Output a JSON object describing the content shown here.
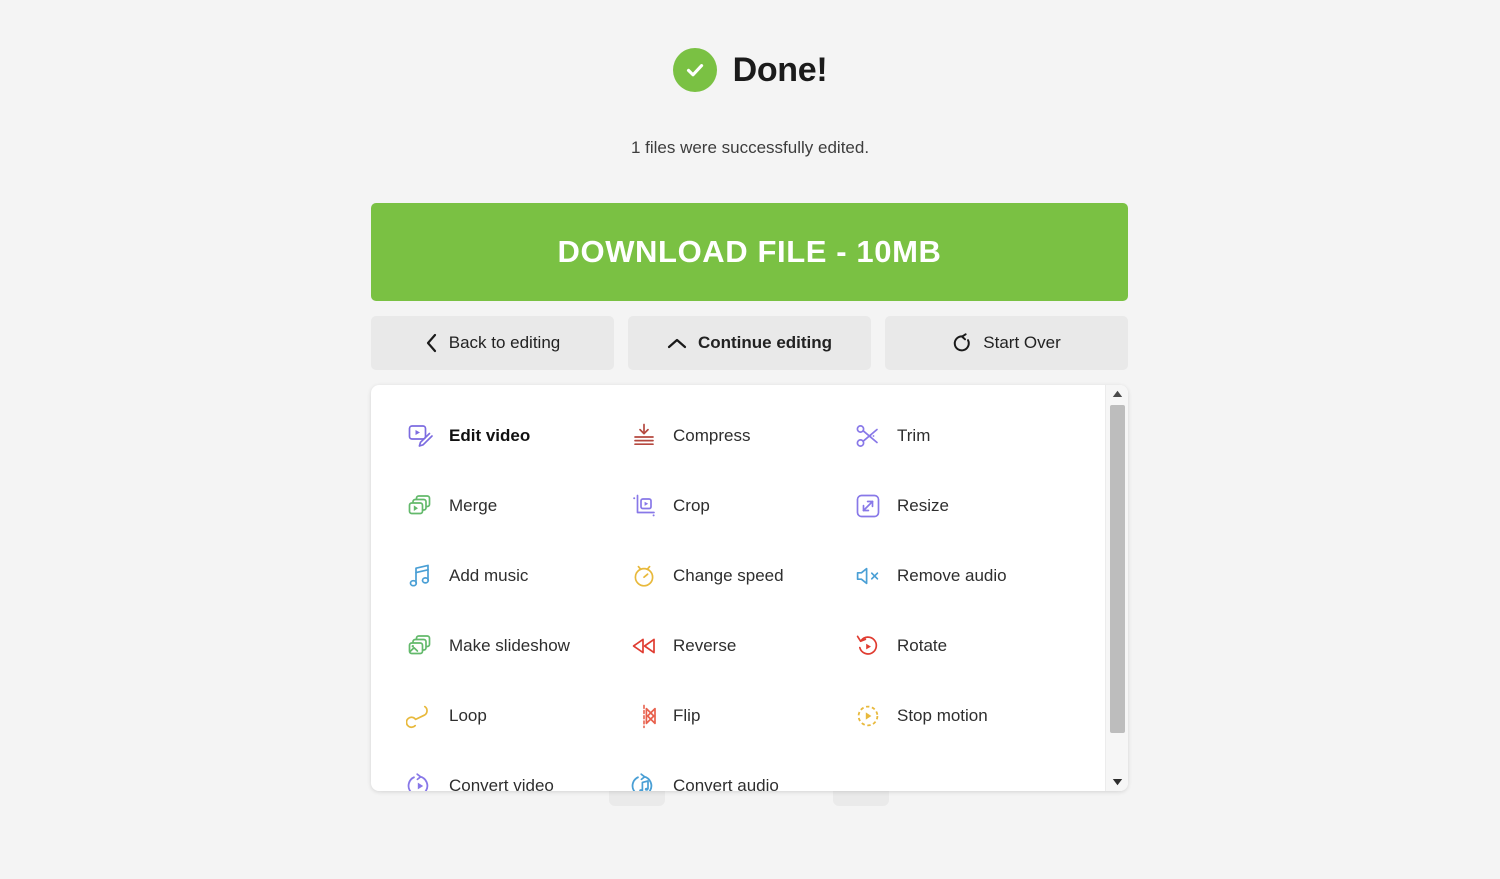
{
  "header": {
    "status_icon": "check-circle-icon",
    "title": "Done!",
    "subtitle": "1 files were successfully edited.",
    "accent_green": "#7ac143"
  },
  "download": {
    "label": "DOWNLOAD FILE - 10MB",
    "color": "#7ac143"
  },
  "actions": [
    {
      "label": "Back to editing",
      "icon": "chevron-left-icon",
      "bold": false
    },
    {
      "label": "Continue editing",
      "icon": "chevron-up-icon",
      "bold": true
    },
    {
      "label": "Start Over",
      "icon": "refresh-icon",
      "bold": false
    }
  ],
  "tools": [
    {
      "label": "Edit video",
      "icon": "video-edit-icon",
      "color": "#7c6ce0",
      "active": true
    },
    {
      "label": "Compress",
      "icon": "compress-icon",
      "color": "#b5483f",
      "active": false
    },
    {
      "label": "Trim",
      "icon": "scissors-icon",
      "color": "#8878e8",
      "active": false
    },
    {
      "label": "Merge",
      "icon": "merge-layers-icon",
      "color": "#63b96b",
      "active": false
    },
    {
      "label": "Crop",
      "icon": "crop-icon",
      "color": "#8878e8",
      "active": false
    },
    {
      "label": "Resize",
      "icon": "resize-arrows-icon",
      "color": "#8878e8",
      "active": false
    },
    {
      "label": "Add music",
      "icon": "music-note-icon",
      "color": "#4a9fd5",
      "active": false
    },
    {
      "label": "Change speed",
      "icon": "stopwatch-icon",
      "color": "#e8b93c",
      "active": false
    },
    {
      "label": "Remove audio",
      "icon": "speaker-mute-icon",
      "color": "#4a9fd5",
      "active": false
    },
    {
      "label": "Make slideshow",
      "icon": "slideshow-icon",
      "color": "#63b96b",
      "active": false
    },
    {
      "label": "Reverse",
      "icon": "rewind-icon",
      "color": "#e03c31",
      "active": false
    },
    {
      "label": "Rotate",
      "icon": "rotate-icon",
      "color": "#e03c31",
      "active": false
    },
    {
      "label": "Loop",
      "icon": "loop-infinity-icon",
      "color": "#e8b93c",
      "active": false
    },
    {
      "label": "Flip",
      "icon": "flip-icon",
      "color": "#e8604c",
      "active": false
    },
    {
      "label": "Stop motion",
      "icon": "stop-motion-icon",
      "color": "#e8b93c",
      "active": false
    },
    {
      "label": "Convert video",
      "icon": "convert-video-icon",
      "color": "#8878e8",
      "active": false
    },
    {
      "label": "Convert audio",
      "icon": "convert-audio-icon",
      "color": "#4a9fd5",
      "active": false
    }
  ],
  "scrollbar": {
    "up_icon": "triangle-up-icon",
    "down_icon": "triangle-down-icon"
  }
}
